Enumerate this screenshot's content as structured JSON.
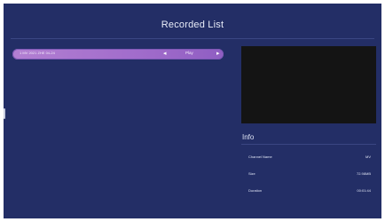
{
  "screen": {
    "title": "Recorded List"
  },
  "recordings": [
    {
      "name": "1 MV 2021 ZHE 04-24",
      "left_arrow": "◂",
      "action_label": "Play",
      "right_arrow": "▸"
    }
  ],
  "info": {
    "title": "Info",
    "rows": [
      {
        "label": "Channel Name",
        "value": "MV"
      },
      {
        "label": "Size",
        "value": "72.98MB"
      },
      {
        "label": "Duration",
        "value": "00:01:44"
      }
    ]
  }
}
